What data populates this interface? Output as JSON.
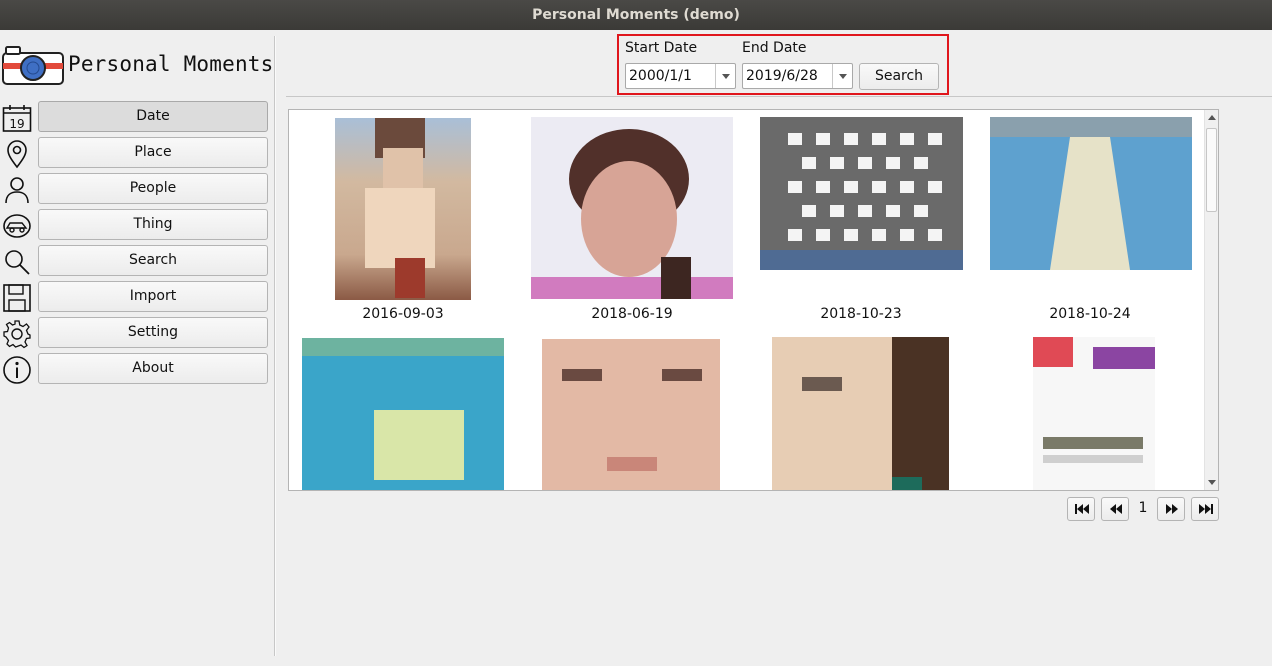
{
  "window": {
    "title": "Personal Moments (demo)"
  },
  "app": {
    "name": "Personal Moments",
    "logo_icon": "camera-icon",
    "accent": "#e0161c"
  },
  "nav": [
    {
      "label": "Date",
      "icon": "calendar-icon",
      "icon_text": "19",
      "active": true
    },
    {
      "label": "Place",
      "icon": "map-pin-icon"
    },
    {
      "label": "People",
      "icon": "person-icon"
    },
    {
      "label": "Thing",
      "icon": "car-icon"
    },
    {
      "label": "Search",
      "icon": "search-icon"
    },
    {
      "label": "Import",
      "icon": "floppy-disk-icon"
    },
    {
      "label": "Setting",
      "icon": "gear-icon"
    },
    {
      "label": "About",
      "icon": "info-icon"
    }
  ],
  "filter": {
    "start_label": "Start Date",
    "start_value": "2000/1/1",
    "end_label": "End Date",
    "end_value": "2019/6/28",
    "search_label": "Search"
  },
  "gallery": {
    "items": [
      {
        "caption": "2016-09-03"
      },
      {
        "caption": "2018-06-19"
      },
      {
        "caption": "2018-10-23"
      },
      {
        "caption": "2018-10-24"
      },
      {
        "caption": ""
      },
      {
        "caption": ""
      },
      {
        "caption": ""
      },
      {
        "caption": ""
      }
    ]
  },
  "pagination": {
    "page": "1"
  }
}
